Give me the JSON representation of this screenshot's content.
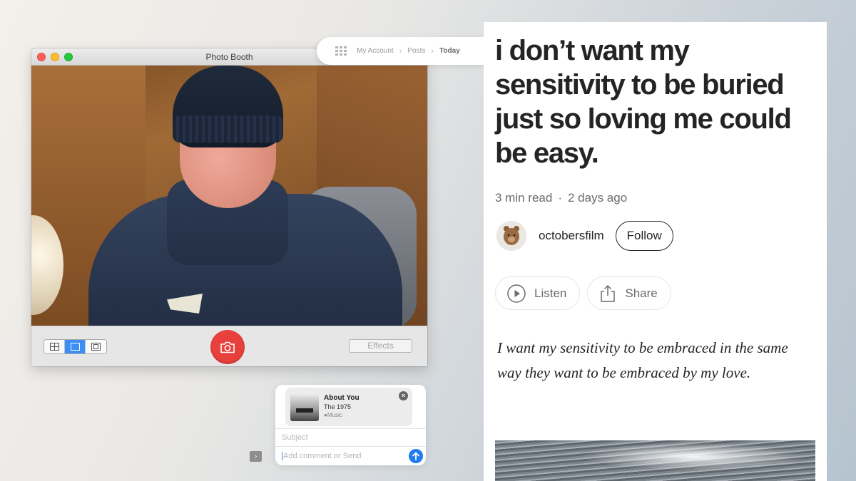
{
  "photo_booth": {
    "window_title": "Photo Booth",
    "effects_label": "Effects",
    "view_modes": [
      "grid-view-icon",
      "single-view-icon",
      "filmstrip-view-icon"
    ],
    "active_view_mode": "single-view-icon",
    "shutter_icon": "camera-icon"
  },
  "breadcrumb": {
    "items": [
      "My Account",
      "Posts",
      "Today"
    ],
    "current": "Today"
  },
  "share_card": {
    "song_title": "About You",
    "artist": "The 1975",
    "service": "Music",
    "subject_placeholder": "Subject",
    "comment_placeholder": "Add comment or Send"
  },
  "article": {
    "title": "i don’t want my sensitivity to be buried just so loving me could be easy.",
    "read_time": "3 min read",
    "separator": "·",
    "posted": "2 days ago",
    "author": "octobersfilm",
    "follow_label": "Follow",
    "listen_label": "Listen",
    "share_label": "Share",
    "quote": "I want my sensitivity to be embraced in the same way they want to be embraced by my love."
  },
  "colors": {
    "shutter": "#e8403d",
    "active_segment": "#3a8ef6",
    "send_button": "#1f7cf0",
    "article_text": "#242424",
    "meta_text": "#6b6b6b"
  }
}
